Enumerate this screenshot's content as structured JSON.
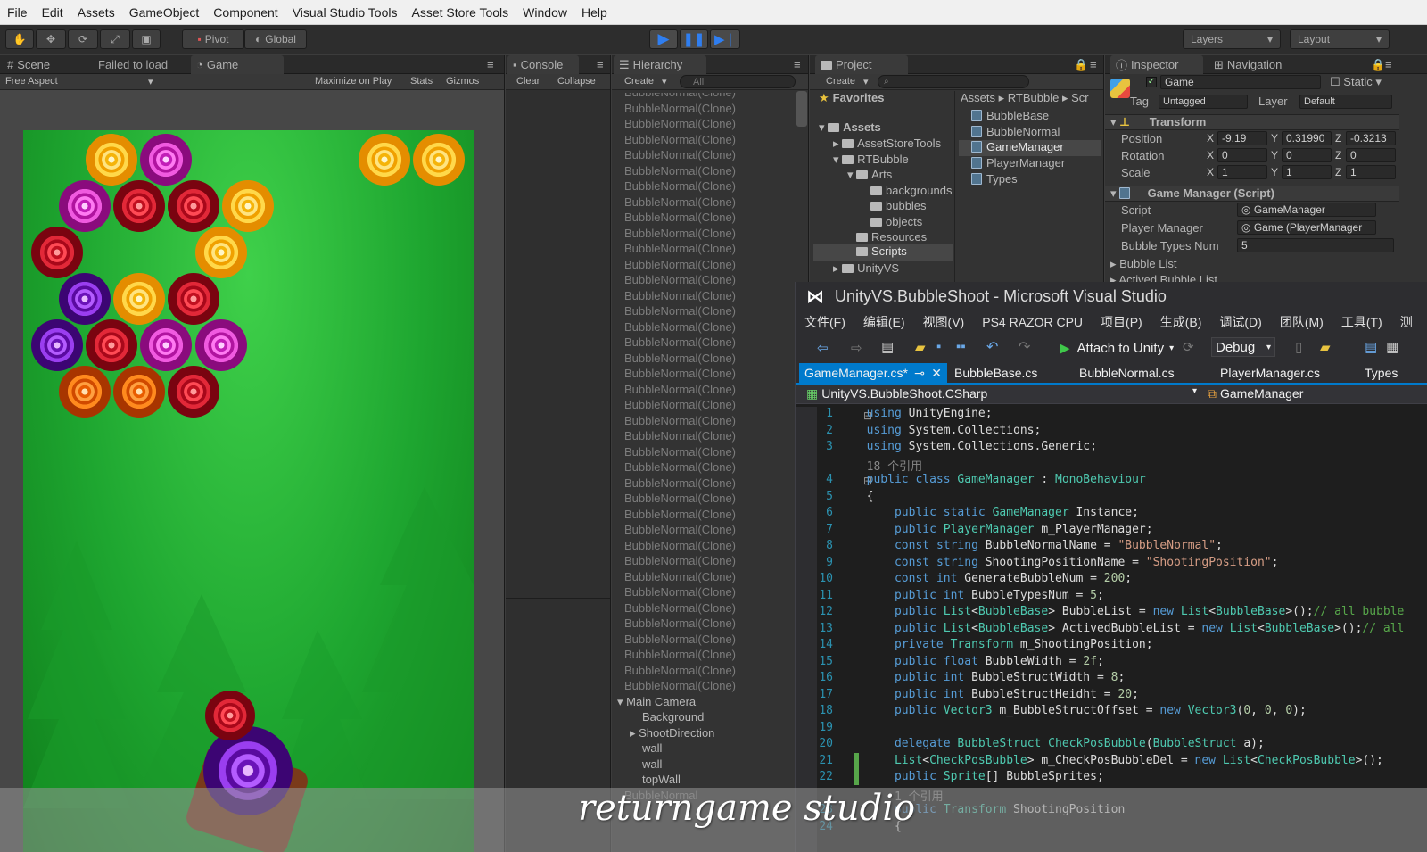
{
  "menu": [
    "File",
    "Edit",
    "Assets",
    "GameObject",
    "Component",
    "Visual Studio Tools",
    "Asset Store Tools",
    "Window",
    "Help"
  ],
  "toolbar": {
    "pivot": "Pivot",
    "global": "Global",
    "layers": "Layers",
    "layout": "Layout"
  },
  "scene": {
    "tab_scene": "Scene",
    "failed": "Failed to load",
    "tab_game": "Game",
    "aspect": "Free Aspect",
    "maximize": "Maximize on Play",
    "stats": "Stats",
    "gizmos": "Gizmos"
  },
  "console": {
    "tab": "Console",
    "clear": "Clear",
    "collapse": "Collapse"
  },
  "hierarchy": {
    "tab": "Hierarchy",
    "create": "Create",
    "search_placeholder": "All",
    "clone_label": "BubbleNormal(Clone)",
    "main_camera": "Main Camera",
    "children": [
      "Background",
      "ShootDirection",
      "wall",
      "wall",
      "topWall"
    ],
    "tail": "BubbleNormal"
  },
  "project": {
    "tab": "Project",
    "create": "Create",
    "favorites": "Favorites",
    "assets": "Assets",
    "tree": [
      "AssetStoreTools",
      "RTBubble",
      "Arts",
      "backgrounds",
      "bubbles",
      "objects",
      "Resources",
      "Scripts",
      "UnityVS"
    ],
    "breadcrumb": [
      "Assets",
      "RTBubble",
      "Scr"
    ],
    "files": [
      "BubbleBase",
      "BubbleNormal",
      "GameManager",
      "PlayerManager",
      "Types"
    ]
  },
  "inspector": {
    "tab": "Inspector",
    "nav_tab": "Navigation",
    "object_name": "Game",
    "static": "Static",
    "tag_label": "Tag",
    "tag_value": "Untagged",
    "layer_label": "Layer",
    "layer_value": "Default",
    "transform": "Transform",
    "position": {
      "label": "Position",
      "x": "-9.19",
      "y": "0.31990",
      "z": "-0.3213"
    },
    "rotation": {
      "label": "Rotation",
      "x": "0",
      "y": "0",
      "z": "0"
    },
    "scale": {
      "label": "Scale",
      "x": "1",
      "y": "1",
      "z": "1"
    },
    "script_component": "Game Manager (Script)",
    "script_label": "Script",
    "script_value": "GameManager",
    "player_label": "Player Manager",
    "player_value": "Game (PlayerManager",
    "types_label": "Bubble Types Num",
    "types_value": "5",
    "bubble_list": "Bubble List",
    "actived_list": "Actived Bubble List"
  },
  "vs": {
    "title": "UnityVS.BubbleShoot - Microsoft Visual Studio",
    "menu": [
      "文件(F)",
      "编辑(E)",
      "视图(V)",
      "PS4 RAZOR CPU",
      "项目(P)",
      "生成(B)",
      "调试(D)",
      "团队(M)",
      "工具(T)",
      "测"
    ],
    "attach": "Attach to Unity",
    "config": "Debug",
    "tabs": [
      "GameManager.cs*",
      "BubbleBase.cs",
      "BubbleNormal.cs",
      "PlayerManager.cs",
      "Types"
    ],
    "nav_project": "UnityVS.BubbleShoot.CSharp",
    "nav_class": "GameManager",
    "code": [
      {
        "n": "1",
        "t": "using UnityEngine;"
      },
      {
        "n": "2",
        "t": "using System.Collections;"
      },
      {
        "n": "3",
        "t": "using System.Collections.Generic;"
      },
      {
        "n": "",
        "t": "18 个引用"
      },
      {
        "n": "4",
        "t": "public class GameManager : MonoBehaviour"
      },
      {
        "n": "5",
        "t": "{"
      },
      {
        "n": "6",
        "t": "    public static GameManager Instance;"
      },
      {
        "n": "7",
        "t": "    public PlayerManager m_PlayerManager;"
      },
      {
        "n": "8",
        "t": "    const string BubbleNormalName = \"BubbleNormal\";"
      },
      {
        "n": "9",
        "t": "    const string ShootingPositionName = \"ShootingPosition\";"
      },
      {
        "n": "10",
        "t": "    const int GenerateBubbleNum = 200;"
      },
      {
        "n": "11",
        "t": "    public int BubbleTypesNum = 5;"
      },
      {
        "n": "12",
        "t": "    public List<BubbleBase> BubbleList = new List<BubbleBase>();// all bubble"
      },
      {
        "n": "13",
        "t": "    public List<BubbleBase> ActivedBubbleList = new List<BubbleBase>();// all"
      },
      {
        "n": "14",
        "t": "    private Transform m_ShootingPosition;"
      },
      {
        "n": "15",
        "t": "    public float BubbleWidth = 2f;"
      },
      {
        "n": "16",
        "t": "    public int BubbleStructWidth = 8;"
      },
      {
        "n": "17",
        "t": "    public int BubbleStructHeidht = 20;"
      },
      {
        "n": "18",
        "t": "    public Vector3 m_BubbleStructOffset = new Vector3(0, 0, 0);"
      },
      {
        "n": "19",
        "t": ""
      },
      {
        "n": "20",
        "t": "    delegate BubbleStruct CheckPosBubble(BubbleStruct a);"
      },
      {
        "n": "21",
        "t": "    List<CheckPosBubble> m_CheckPosBubbleDel = new List<CheckPosBubble>();"
      },
      {
        "n": "22",
        "t": "    public Sprite[] BubbleSprites;"
      },
      {
        "n": "",
        "t": "    1 个引用"
      },
      {
        "n": "23",
        "t": "    public Transform ShootingPosition"
      },
      {
        "n": "24",
        "t": "    {"
      }
    ]
  },
  "watermark": "returngame studio",
  "colors": {
    "accent": "#007acc",
    "game_bg": "#21b337",
    "play_blue": "#2f7ef0"
  }
}
